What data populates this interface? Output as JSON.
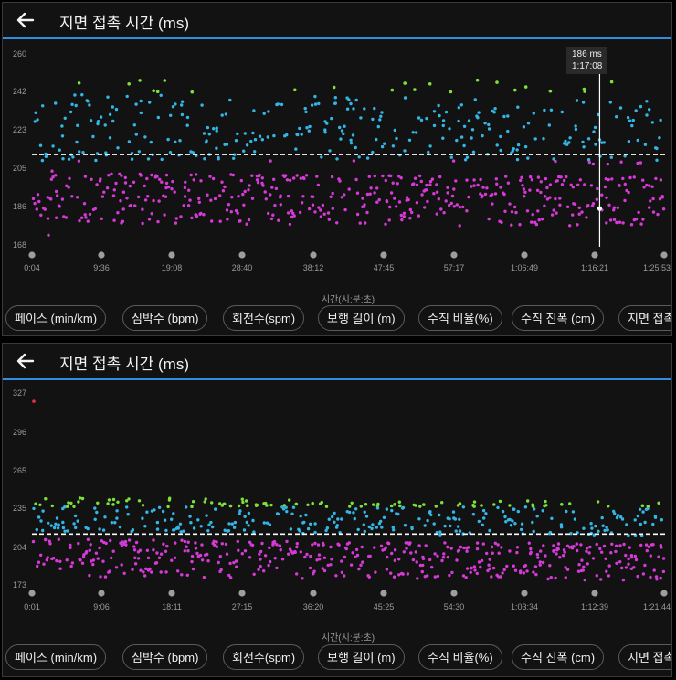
{
  "panels": [
    {
      "title": "지면 접촉 시간 (ms)",
      "x_axis_title": "시간(시:분:초)",
      "tooltip": {
        "value": "186 ms",
        "time": "1:17:08"
      },
      "chips": [
        "페이스 (min/km)",
        "심박수 (bpm)",
        "회전수(spm)",
        "보행 길이 (m)",
        "수직 비율(%)",
        "수직 진폭 (cm)",
        "지면 접촉"
      ],
      "chart_data": {
        "type": "scatter",
        "yticks": [
          "260",
          "242",
          "223",
          "205",
          "186",
          "168"
        ],
        "xticks": [
          "0:04",
          "9:36",
          "19:08",
          "28:40",
          "38:12",
          "47:45",
          "57:17",
          "1:06:49",
          "1:16:21",
          "1:25:53"
        ],
        "ylim": [
          168,
          260
        ],
        "average": 212,
        "highlight": {
          "time": "1:17:08",
          "value": 186
        },
        "trend_start": 205,
        "trend_end": 203,
        "seed": 17,
        "colors": {
          "high": "#7ee03a",
          "mid": "#33b6e6",
          "low": "#d63ad6",
          "avg_line": "#ffffff"
        }
      }
    },
    {
      "title": "지면 접촉 시간 (ms)",
      "x_axis_title": "시간(시:분:초)",
      "chips": [
        "페이스 (min/km)",
        "심박수 (bpm)",
        "회전수(spm)",
        "보행 길이 (m)",
        "수직 비율(%)",
        "수직 진폭 (cm)",
        "지면 접촉"
      ],
      "chart_data": {
        "type": "scatter",
        "yticks": [
          "327",
          "296",
          "265",
          "235",
          "204",
          "173"
        ],
        "xticks": [
          "0:01",
          "9:06",
          "18:11",
          "27:15",
          "36:20",
          "45:25",
          "54:30",
          "1:03:34",
          "1:12:39",
          "1:21:44"
        ],
        "ylim": [
          173,
          327
        ],
        "average": 214,
        "outlier": {
          "time": "0:01",
          "value": 321
        },
        "trend_start": 212,
        "trend_end": 208,
        "seed": 91,
        "colors": {
          "high": "#7ee03a",
          "mid": "#33b6e6",
          "low": "#d63ad6",
          "outlier": "#e0304a",
          "avg_line": "#ffffff"
        }
      }
    }
  ]
}
